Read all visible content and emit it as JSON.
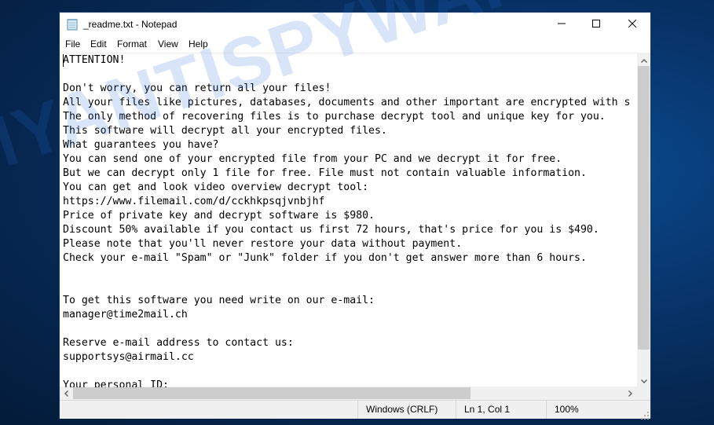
{
  "window": {
    "title": "_readme.txt - Notepad",
    "icon": "notepad-icon",
    "controls": {
      "minimize": "minimize-icon",
      "maximize": "maximize-icon",
      "close": "close-icon"
    }
  },
  "menu": {
    "items": [
      {
        "label": "File"
      },
      {
        "label": "Edit"
      },
      {
        "label": "Format"
      },
      {
        "label": "View"
      },
      {
        "label": "Help"
      }
    ]
  },
  "document": {
    "lines": [
      "ATTENTION!",
      "",
      "Don't worry, you can return all your files!",
      "All your files like pictures, databases, documents and other important are encrypted with s",
      "The only method of recovering files is to purchase decrypt tool and unique key for you.",
      "This software will decrypt all your encrypted files.",
      "What guarantees you have?",
      "You can send one of your encrypted file from your PC and we decrypt it for free.",
      "But we can decrypt only 1 file for free. File must not contain valuable information.",
      "You can get and look video overview decrypt tool:",
      "https://www.filemail.com/d/cckhkpsqjvnbjhf",
      "Price of private key and decrypt software is $980.",
      "Discount 50% available if you contact us first 72 hours, that's price for you is $490.",
      "Please note that you'll never restore your data without payment.",
      "Check your e-mail \"Spam\" or \"Junk\" folder if you don't get answer more than 6 hours.",
      "",
      "",
      "To get this software you need write on our e-mail:",
      "manager@time2mail.ch",
      "",
      "Reserve e-mail address to contact us:",
      "supportsys@airmail.cc",
      "",
      "Your personal ID:"
    ]
  },
  "watermark": "MYANTISPYWARE.COM",
  "statusbar": {
    "line_ending": "Windows (CRLF)",
    "position": "Ln 1, Col 1",
    "zoom": "100%"
  }
}
